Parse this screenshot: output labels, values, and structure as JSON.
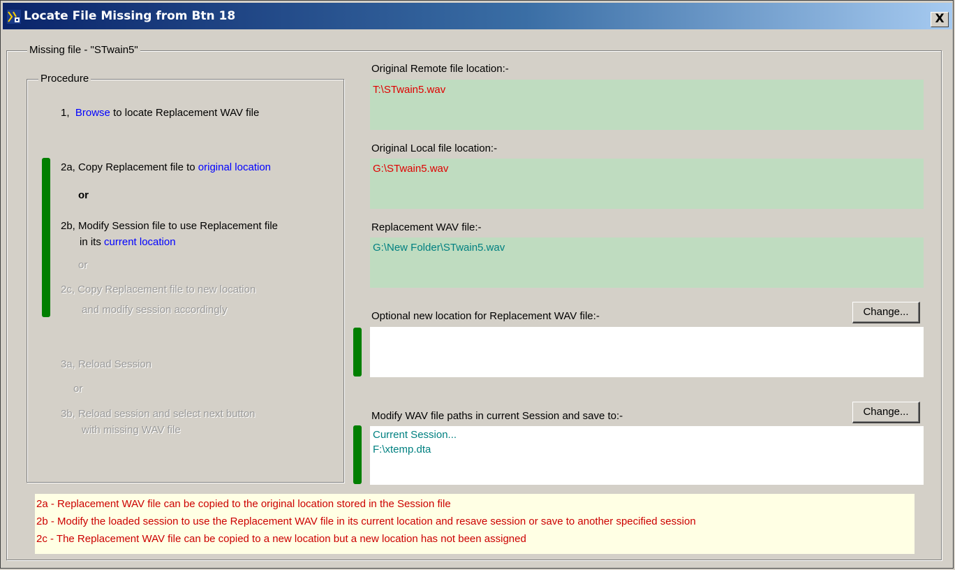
{
  "window": {
    "title": "Locate File Missing from Btn 18",
    "close_label": "X"
  },
  "group": {
    "legend": "Missing file - \"STwain5\""
  },
  "procedure": {
    "legend": "Procedure",
    "step1_prefix": "1,",
    "step1_link": "Browse",
    "step1_suffix": "to locate Replacement WAV file",
    "step2a_prefix": "2a, Copy Replacement file to",
    "step2a_link": "original location",
    "or1": "or",
    "step2b_line1": "2b, Modify Session file to use Replacement file",
    "step2b_line2_prefix": "in its",
    "step2b_link": "current location",
    "or2": "or",
    "step2c_line1": "2c, Copy Replacement file to new location",
    "step2c_line2": "and modify session accordingly",
    "step3a": "3a, Reload Session",
    "or3": "or",
    "step3b_line1": "3b, Reload session and select next button",
    "step3b_line2": "with missing WAV file"
  },
  "fields": {
    "remote_label": "Original Remote file location:-",
    "remote_value": "T:\\STwain5.wav",
    "local_label": "Original Local file location:-",
    "local_value": "G:\\STwain5.wav",
    "replacement_label": "Replacement WAV file:-",
    "replacement_value": "G:\\New Folder\\STwain5.wav",
    "new_location_label": "Optional new location for Replacement WAV file:-",
    "new_location_value": "",
    "new_location_button": "Change...",
    "session_label": "Modify WAV file paths in current Session and save to:-",
    "session_line1": "Current Session...",
    "session_line2": "F:\\xtemp.dta",
    "session_button": "Change..."
  },
  "notes": [
    "2a - Replacement WAV file can be copied to the original location stored in the Session file",
    "2b - Modify the loaded session to use the Replacement WAV file in its current location and resave session or save to another specified session",
    "2c - The Replacement WAV file can be copied to a new location but a new location has not been assigned"
  ],
  "colors": {
    "readonly_field": "#bfdcc0",
    "path_red": "#e00000",
    "path_teal": "#008080",
    "indicator_green": "#007f00",
    "notes_bg": "#ffffe4",
    "notes_text": "#cc0000",
    "link_blue": "#0000ff"
  }
}
